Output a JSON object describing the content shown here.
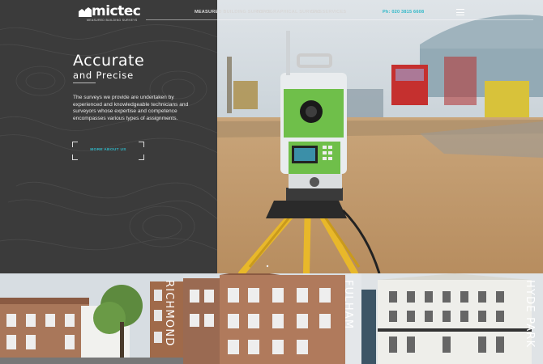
{
  "header": {
    "logo_text": "mictec",
    "logo_subtext": "MEASURED BUILDING SURVEYS",
    "nav": [
      {
        "label": "MEASURED BUILDING SURVEYS"
      },
      {
        "label": "TOPOGRAPHICAL SURVEYS"
      },
      {
        "label": "CAD SERVICES"
      }
    ],
    "phone": "Ph: 020 3815 6608",
    "menu_icon": "hamburger-icon"
  },
  "hero": {
    "title": "Accurate",
    "subtitle": "and Precise",
    "description": "The surveys we provide are undertaken by experienced and knowledgeable technicians and surveyors whose expertise and competence encompasses various types of assignments.",
    "cta_label": "MORE ABOUT US",
    "image_alt": "total-station-surveying-instrument",
    "slide_count": 3,
    "active_slide": 1
  },
  "locations": [
    {
      "label": "RICHMOND"
    },
    {
      "label": "FULHAM"
    },
    {
      "label": "HYDE PARK"
    }
  ],
  "colors": {
    "accent": "#2fb8c8",
    "panel": "#3b3b3b",
    "tripod": "#e8b82a",
    "instrument": "#6fbf4a"
  }
}
